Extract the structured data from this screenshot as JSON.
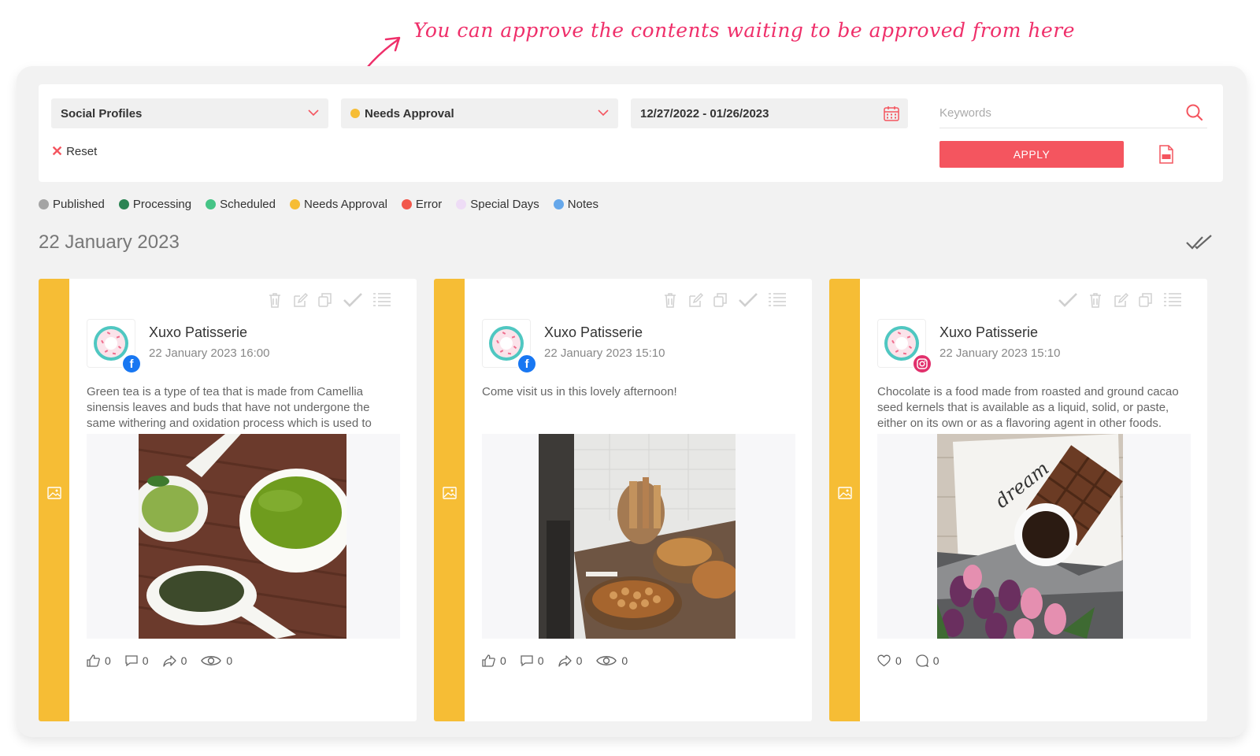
{
  "annotation": {
    "text": "You can approve the contents waiting to be approved from here"
  },
  "filters": {
    "profiles_label": "Social Profiles",
    "status_label": "Needs Approval",
    "status_color": "#f6bd35",
    "date_range": "12/27/2022 - 01/26/2023",
    "keywords_placeholder": "Keywords",
    "reset_label": "Reset",
    "apply_label": "APPLY"
  },
  "legend": [
    {
      "label": "Published",
      "color": "#a4a4a4"
    },
    {
      "label": "Processing",
      "color": "#2b8453"
    },
    {
      "label": "Scheduled",
      "color": "#45c486"
    },
    {
      "label": "Needs Approval",
      "color": "#f6bd35"
    },
    {
      "label": "Error",
      "color": "#f2584c"
    },
    {
      "label": "Special Days",
      "color": "#eedcf6"
    },
    {
      "label": "Notes",
      "color": "#65a7ea"
    }
  ],
  "date_heading": "22 January 2023",
  "posts": [
    {
      "account": "Xuxo Patisserie",
      "time": "22 January 2023 16:00",
      "network": "facebook",
      "text": "Green tea is a type of tea that is made from Camellia sinensis leaves and buds that have not undergone the same withering and oxidation process which is used to make oolong and black teas.",
      "likes": "0",
      "comments": "0",
      "shares": "0",
      "views": "0"
    },
    {
      "account": "Xuxo Patisserie",
      "time": "22 January 2023 15:10",
      "network": "facebook",
      "text": "Come visit us in this lovely afternoon!",
      "likes": "0",
      "comments": "0",
      "shares": "0",
      "views": "0"
    },
    {
      "account": "Xuxo Patisserie",
      "time": "22 January 2023 15:10",
      "network": "instagram",
      "text": "Chocolate is a food made from roasted and ground cacao seed kernels that is available as a liquid, solid, or paste, either on its own or as a flavoring agent in other foods.",
      "likes": "0",
      "comments": "0"
    }
  ],
  "colors": {
    "accent": "#f4555f",
    "approval": "#f6bd35",
    "facebook": "#1877f2",
    "instagram": "#e1306c",
    "annotation": "#ef2f6a"
  }
}
